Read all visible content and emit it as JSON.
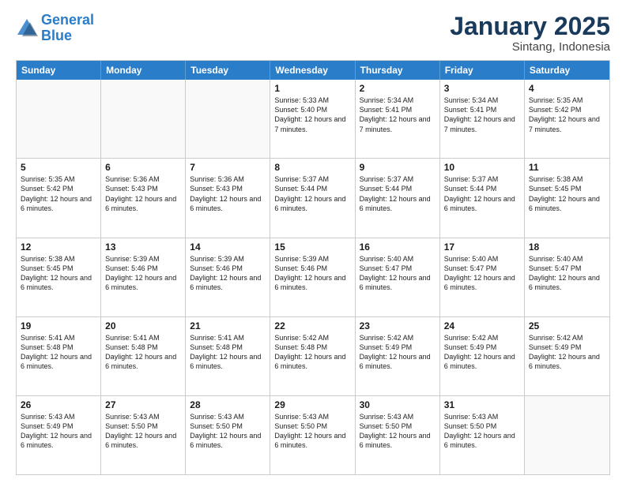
{
  "logo": {
    "line1": "General",
    "line2": "Blue"
  },
  "title": "January 2025",
  "subtitle": "Sintang, Indonesia",
  "days": [
    "Sunday",
    "Monday",
    "Tuesday",
    "Wednesday",
    "Thursday",
    "Friday",
    "Saturday"
  ],
  "rows": [
    [
      {
        "day": "",
        "empty": true
      },
      {
        "day": "",
        "empty": true
      },
      {
        "day": "",
        "empty": true
      },
      {
        "day": "1",
        "sunrise": "5:33 AM",
        "sunset": "5:40 PM",
        "daylight": "12 hours and 7 minutes."
      },
      {
        "day": "2",
        "sunrise": "5:34 AM",
        "sunset": "5:41 PM",
        "daylight": "12 hours and 7 minutes."
      },
      {
        "day": "3",
        "sunrise": "5:34 AM",
        "sunset": "5:41 PM",
        "daylight": "12 hours and 7 minutes."
      },
      {
        "day": "4",
        "sunrise": "5:35 AM",
        "sunset": "5:42 PM",
        "daylight": "12 hours and 7 minutes."
      }
    ],
    [
      {
        "day": "5",
        "sunrise": "5:35 AM",
        "sunset": "5:42 PM",
        "daylight": "12 hours and 6 minutes."
      },
      {
        "day": "6",
        "sunrise": "5:36 AM",
        "sunset": "5:43 PM",
        "daylight": "12 hours and 6 minutes."
      },
      {
        "day": "7",
        "sunrise": "5:36 AM",
        "sunset": "5:43 PM",
        "daylight": "12 hours and 6 minutes."
      },
      {
        "day": "8",
        "sunrise": "5:37 AM",
        "sunset": "5:44 PM",
        "daylight": "12 hours and 6 minutes."
      },
      {
        "day": "9",
        "sunrise": "5:37 AM",
        "sunset": "5:44 PM",
        "daylight": "12 hours and 6 minutes."
      },
      {
        "day": "10",
        "sunrise": "5:37 AM",
        "sunset": "5:44 PM",
        "daylight": "12 hours and 6 minutes."
      },
      {
        "day": "11",
        "sunrise": "5:38 AM",
        "sunset": "5:45 PM",
        "daylight": "12 hours and 6 minutes."
      }
    ],
    [
      {
        "day": "12",
        "sunrise": "5:38 AM",
        "sunset": "5:45 PM",
        "daylight": "12 hours and 6 minutes."
      },
      {
        "day": "13",
        "sunrise": "5:39 AM",
        "sunset": "5:46 PM",
        "daylight": "12 hours and 6 minutes."
      },
      {
        "day": "14",
        "sunrise": "5:39 AM",
        "sunset": "5:46 PM",
        "daylight": "12 hours and 6 minutes."
      },
      {
        "day": "15",
        "sunrise": "5:39 AM",
        "sunset": "5:46 PM",
        "daylight": "12 hours and 6 minutes."
      },
      {
        "day": "16",
        "sunrise": "5:40 AM",
        "sunset": "5:47 PM",
        "daylight": "12 hours and 6 minutes."
      },
      {
        "day": "17",
        "sunrise": "5:40 AM",
        "sunset": "5:47 PM",
        "daylight": "12 hours and 6 minutes."
      },
      {
        "day": "18",
        "sunrise": "5:40 AM",
        "sunset": "5:47 PM",
        "daylight": "12 hours and 6 minutes."
      }
    ],
    [
      {
        "day": "19",
        "sunrise": "5:41 AM",
        "sunset": "5:48 PM",
        "daylight": "12 hours and 6 minutes."
      },
      {
        "day": "20",
        "sunrise": "5:41 AM",
        "sunset": "5:48 PM",
        "daylight": "12 hours and 6 minutes."
      },
      {
        "day": "21",
        "sunrise": "5:41 AM",
        "sunset": "5:48 PM",
        "daylight": "12 hours and 6 minutes."
      },
      {
        "day": "22",
        "sunrise": "5:42 AM",
        "sunset": "5:48 PM",
        "daylight": "12 hours and 6 minutes."
      },
      {
        "day": "23",
        "sunrise": "5:42 AM",
        "sunset": "5:49 PM",
        "daylight": "12 hours and 6 minutes."
      },
      {
        "day": "24",
        "sunrise": "5:42 AM",
        "sunset": "5:49 PM",
        "daylight": "12 hours and 6 minutes."
      },
      {
        "day": "25",
        "sunrise": "5:42 AM",
        "sunset": "5:49 PM",
        "daylight": "12 hours and 6 minutes."
      }
    ],
    [
      {
        "day": "26",
        "sunrise": "5:43 AM",
        "sunset": "5:49 PM",
        "daylight": "12 hours and 6 minutes."
      },
      {
        "day": "27",
        "sunrise": "5:43 AM",
        "sunset": "5:50 PM",
        "daylight": "12 hours and 6 minutes."
      },
      {
        "day": "28",
        "sunrise": "5:43 AM",
        "sunset": "5:50 PM",
        "daylight": "12 hours and 6 minutes."
      },
      {
        "day": "29",
        "sunrise": "5:43 AM",
        "sunset": "5:50 PM",
        "daylight": "12 hours and 6 minutes."
      },
      {
        "day": "30",
        "sunrise": "5:43 AM",
        "sunset": "5:50 PM",
        "daylight": "12 hours and 6 minutes."
      },
      {
        "day": "31",
        "sunrise": "5:43 AM",
        "sunset": "5:50 PM",
        "daylight": "12 hours and 6 minutes."
      },
      {
        "day": "",
        "empty": true
      }
    ]
  ]
}
